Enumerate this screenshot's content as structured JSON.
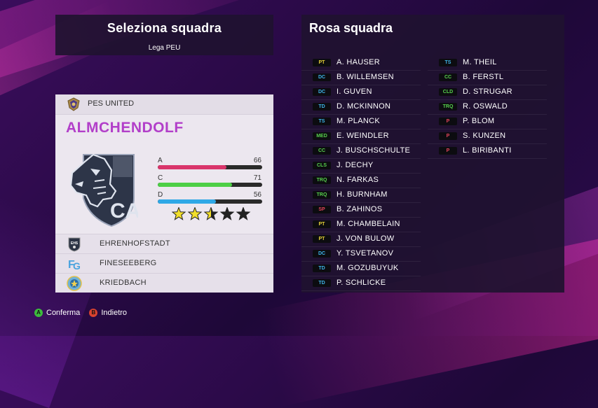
{
  "header": {
    "title": "Seleziona squadra",
    "league": "Lega PEU"
  },
  "team": {
    "league_name": "PES UNITED",
    "name": "ALMCHENDOLF",
    "stats": [
      {
        "key": "A",
        "value": "66",
        "percent": 66,
        "color": "#d9356b"
      },
      {
        "key": "C",
        "value": "71",
        "percent": 71,
        "color": "#4ccf45"
      },
      {
        "key": "D",
        "value": "56",
        "percent": 56,
        "color": "#2fa8e6"
      }
    ],
    "stars": 2.5,
    "stars_max": 5,
    "rivals": [
      {
        "name": "EHRENHOFSTADT",
        "icon": "ehrenhofstadt-crest-icon"
      },
      {
        "name": "FINESEEBERG",
        "icon": "fineseeberg-crest-icon"
      },
      {
        "name": "KRIEDBACH",
        "icon": "kriedbach-crest-icon"
      }
    ]
  },
  "roster": {
    "title": "Rosa squadra",
    "left": [
      {
        "pos": "PT",
        "color": "#e6d23a",
        "name": "A. HAUSER"
      },
      {
        "pos": "DC",
        "color": "#3fb6ea",
        "name": "B. WILLEMSEN"
      },
      {
        "pos": "DC",
        "color": "#3fb6ea",
        "name": "I. GUVEN"
      },
      {
        "pos": "TD",
        "color": "#3fb6ea",
        "name": "D. MCKINNON"
      },
      {
        "pos": "TS",
        "color": "#3fb6ea",
        "name": "M. PLANCK"
      },
      {
        "pos": "MED",
        "color": "#58d14e",
        "name": "E. WEINDLER"
      },
      {
        "pos": "CC",
        "color": "#58d14e",
        "name": "J. BUSCHSCHULTE"
      },
      {
        "pos": "CLS",
        "color": "#58d14e",
        "name": "J. DECHY"
      },
      {
        "pos": "TRQ",
        "color": "#58d14e",
        "name": "N. FARKAS"
      },
      {
        "pos": "TRQ",
        "color": "#58d14e",
        "name": "H. BURNHAM"
      },
      {
        "pos": "SP",
        "color": "#e3465c",
        "name": "B. ZAHINOS"
      },
      {
        "pos": "PT",
        "color": "#e6d23a",
        "name": "M. CHAMBELAIN"
      },
      {
        "pos": "PT",
        "color": "#e6d23a",
        "name": "J. VON BULOW"
      },
      {
        "pos": "DC",
        "color": "#3fb6ea",
        "name": "Y. TSVETANOV"
      },
      {
        "pos": "TD",
        "color": "#3fb6ea",
        "name": "M. GOZUBUYUK"
      },
      {
        "pos": "TD",
        "color": "#3fb6ea",
        "name": "P. SCHLICKE"
      }
    ],
    "right": [
      {
        "pos": "TS",
        "color": "#3fb6ea",
        "name": "M. THEIL"
      },
      {
        "pos": "CC",
        "color": "#58d14e",
        "name": "B. FERSTL"
      },
      {
        "pos": "CLD",
        "color": "#58d14e",
        "name": "D. STRUGAR"
      },
      {
        "pos": "TRQ",
        "color": "#58d14e",
        "name": "R. OSWALD"
      },
      {
        "pos": "P",
        "color": "#e3465c",
        "name": "P. BLOM"
      },
      {
        "pos": "P",
        "color": "#e3465c",
        "name": "S. KUNZEN"
      },
      {
        "pos": "P",
        "color": "#e3465c",
        "name": "L. BIRIBANTI"
      }
    ]
  },
  "hints": [
    {
      "button": "A",
      "button_color": "#3dbb3d",
      "label": "Conferma"
    },
    {
      "button": "B",
      "button_color": "#d9432f",
      "label": "Indietro"
    }
  ]
}
